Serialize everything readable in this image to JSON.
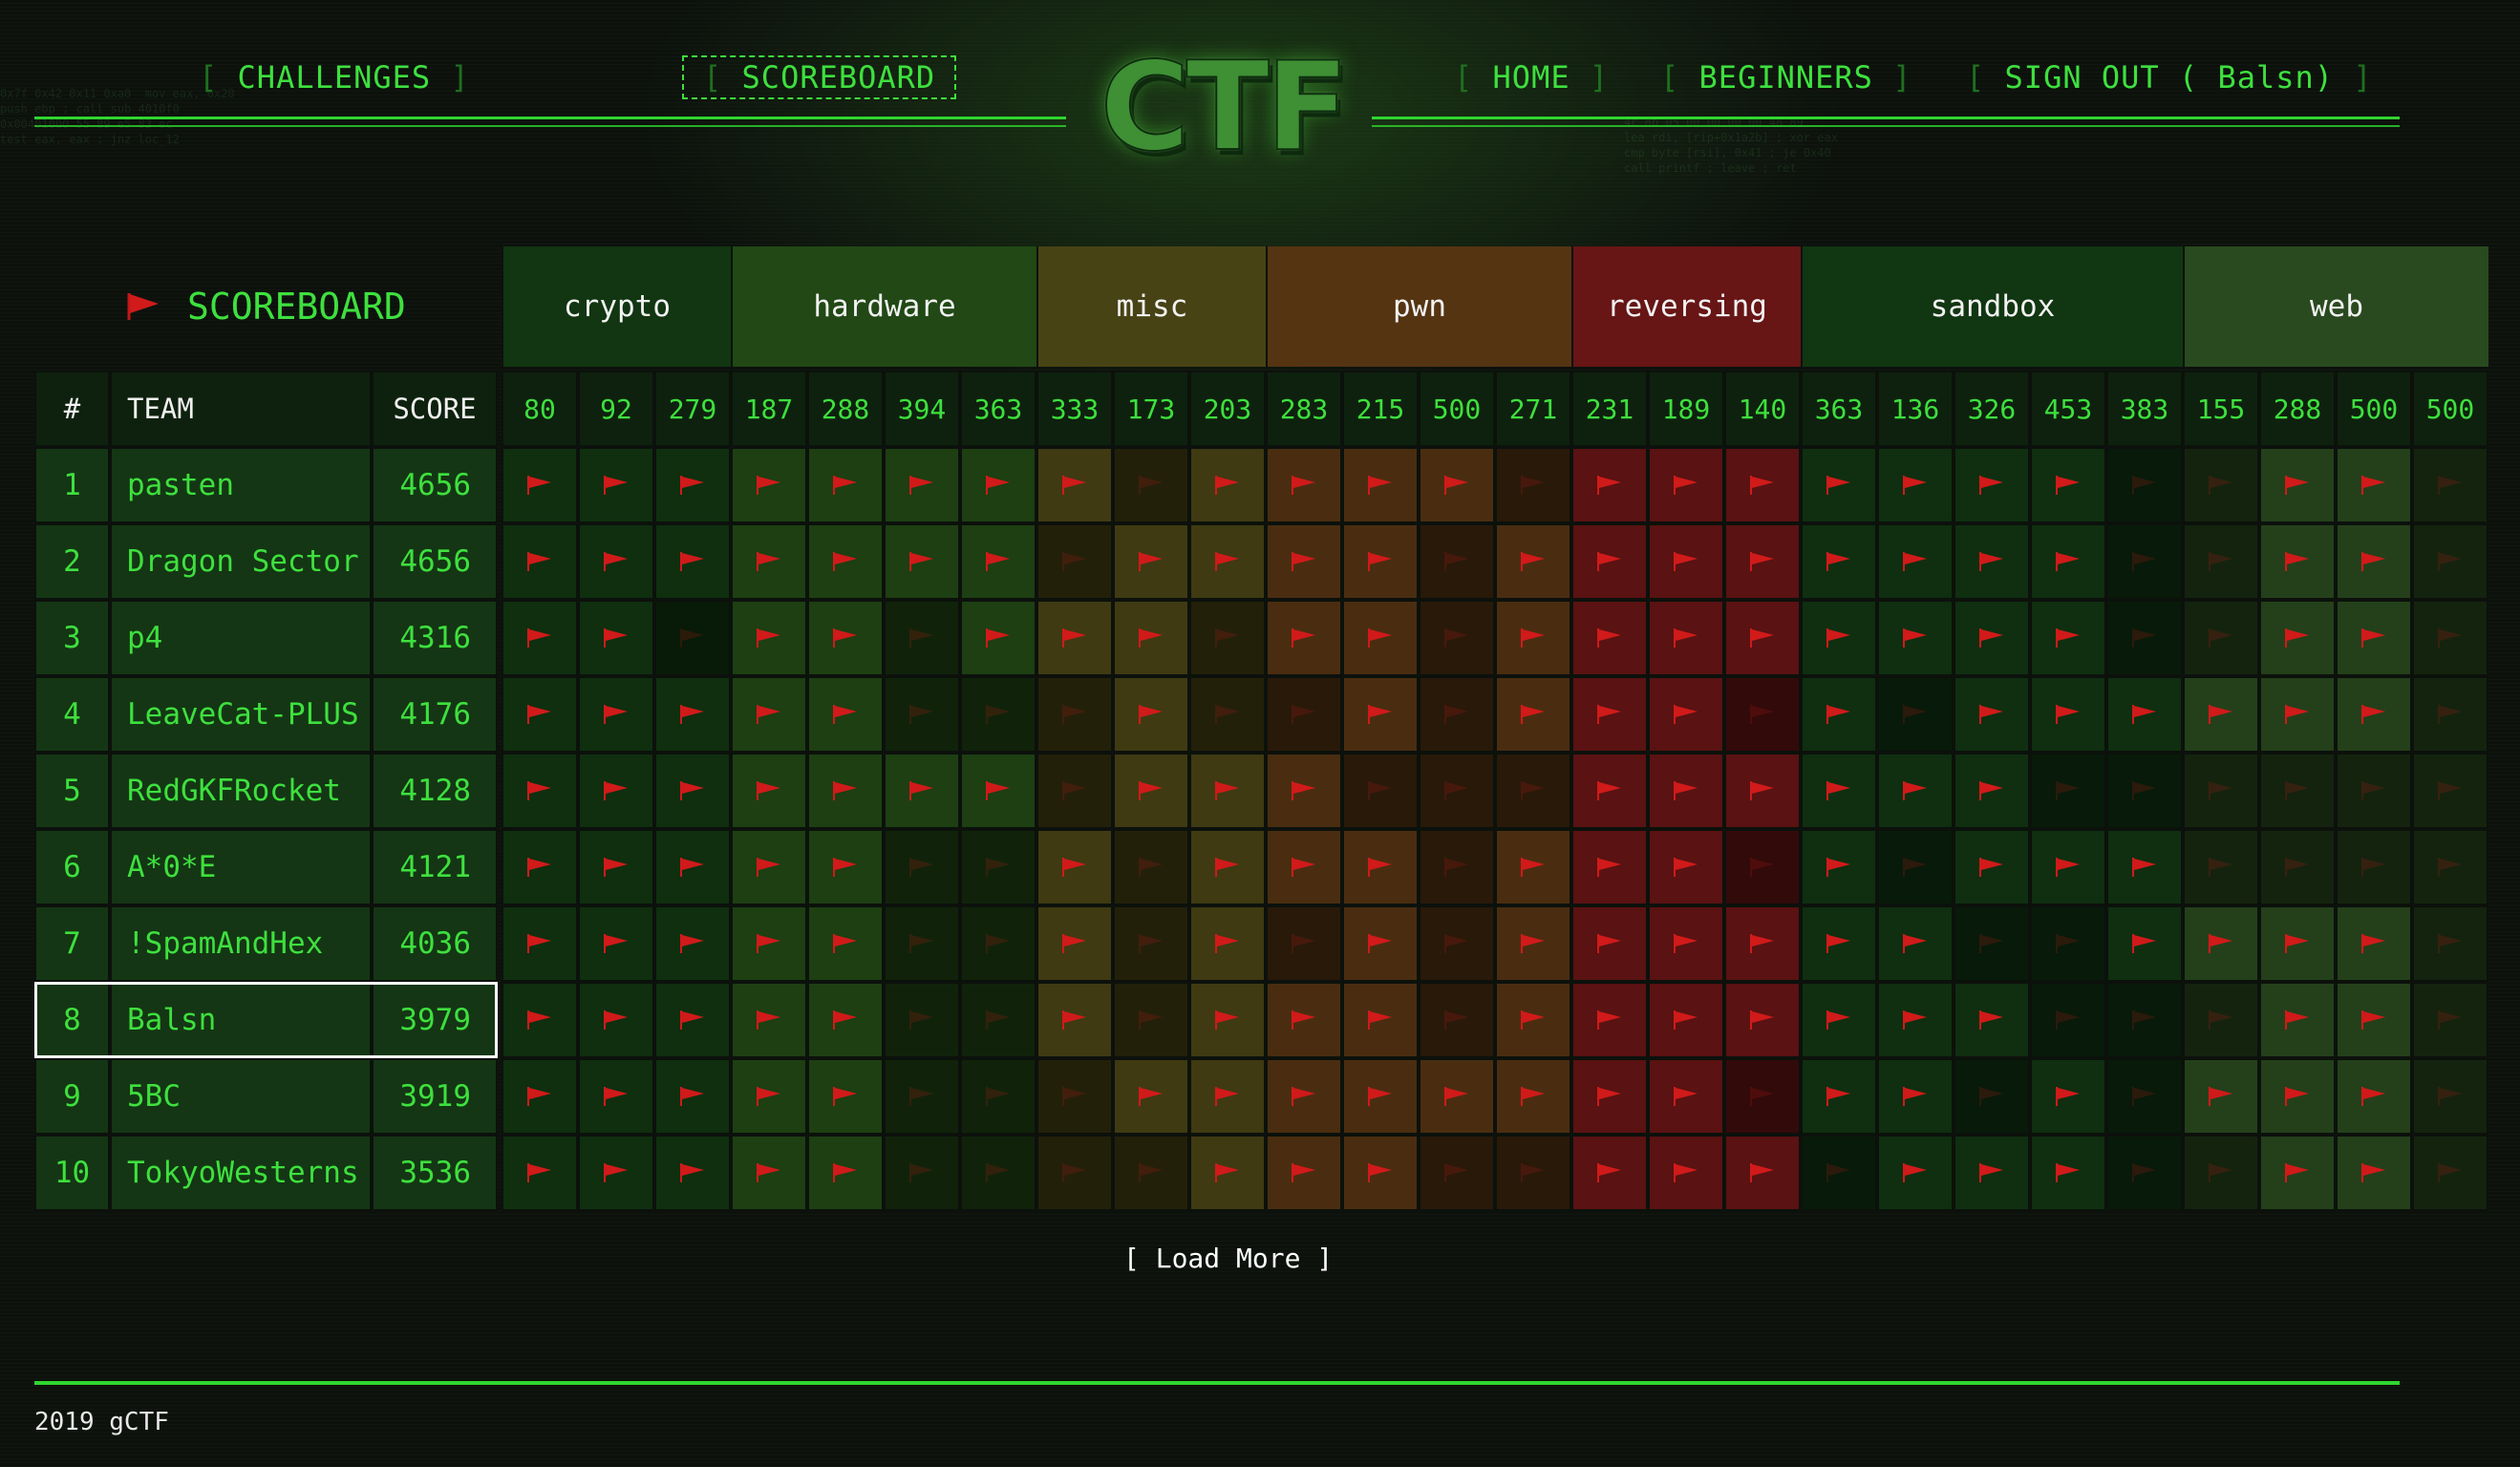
{
  "nav": {
    "challenges": "CHALLENGES",
    "scoreboard": "SCOREBOARD",
    "home": "HOME",
    "beginners": "BEGINNERS",
    "signout": "SIGN OUT ( Balsn)",
    "bracket_open": "[",
    "bracket_close": "]",
    "logo": "CTF"
  },
  "board": {
    "title": "SCOREBOARD",
    "headers": {
      "rank": "#",
      "team": "TEAM",
      "score": "SCORE"
    },
    "categories": [
      {
        "name": "crypto",
        "count": 3,
        "color": "#0f2f0f"
      },
      {
        "name": "hardware",
        "count": 4,
        "color": "#1d3f12"
      },
      {
        "name": "misc",
        "count": 3,
        "color": "#3f3a12"
      },
      {
        "name": "pwn",
        "count": 4,
        "color": "#4a2d10"
      },
      {
        "name": "reversing",
        "count": 3,
        "color": "#5a1212"
      },
      {
        "name": "sandbox",
        "count": 5,
        "color": "#0f2f10"
      },
      {
        "name": "web",
        "count": 4,
        "color": "#24401a"
      }
    ],
    "challenge_points": [
      "80",
      "92",
      "279",
      "187",
      "288",
      "394",
      "363",
      "333",
      "173",
      "203",
      "283",
      "215",
      "500",
      "271",
      "231",
      "189",
      "140",
      "363",
      "136",
      "326",
      "453",
      "383",
      "155",
      "288",
      "500",
      "500"
    ],
    "teams": [
      {
        "rank": "1",
        "name": "pasten",
        "score": "4656",
        "solved": "11111111011110111111100110"
      },
      {
        "rank": "2",
        "name": "Dragon Sector",
        "score": "4656",
        "solved": "11111110111101111111100110"
      },
      {
        "rank": "3",
        "name": "p4",
        "score": "4316",
        "solved": "11011011101101111111100110"
      },
      {
        "rank": "4",
        "name": "LeaveCat-PLUS",
        "score": "4176",
        "solved": "11111000100101110101111110"
      },
      {
        "rank": "5",
        "name": "RedGKFRocket",
        "score": "4128",
        "solved": "11111110111000111111000000"
      },
      {
        "rank": "6",
        "name": "A*0*E",
        "score": "4121",
        "solved": "11111001011101110101110000"
      },
      {
        "rank": "7",
        "name": "!SpamAndHex",
        "score": "4036",
        "solved": "11111001010101111110011110"
      },
      {
        "rank": "8",
        "name": "Balsn",
        "score": "3979",
        "solved": "11111001011101111111000110"
      },
      {
        "rank": "9",
        "name": "5BC",
        "score": "3919",
        "solved": "11111000111111110110101110"
      },
      {
        "rank": "10",
        "name": "TokyoWesterns",
        "score": "3536",
        "solved": "11111000011100111011100110"
      }
    ],
    "selected_rank": "8",
    "load_more": "[ Load More ]"
  },
  "footer": {
    "copyright": "2019 gCTF"
  },
  "colors": {
    "accent": "#3ee03e",
    "flag": "#d11a1a",
    "cell_dark": "#0c110c"
  }
}
